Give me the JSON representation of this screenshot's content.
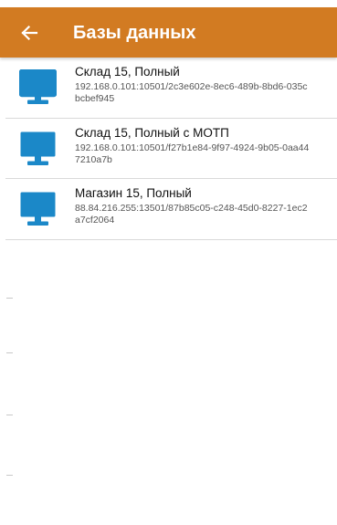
{
  "app_bar": {
    "title": "Базы данных",
    "back_icon": "arrow-left-icon",
    "color": "#d27b22"
  },
  "databases": [
    {
      "icon": "monitor-icon",
      "name": "Склад 15, Полный",
      "address": "192.168.0.101:10501/2c3e602e-8ec6-489b-8bd6-035cbcbef945"
    },
    {
      "icon": "monitor-icon",
      "name": "Склад 15, Полный с МОТП",
      "address": "192.168.0.101:10501/f27b1e84-9f97-4924-9b05-0aa447210a7b"
    },
    {
      "icon": "monitor-icon",
      "name": "Магазин 15, Полный",
      "address": "88.84.216.255:13501/87b85c05-c248-45d0-8227-1ec2a7cf2064"
    }
  ],
  "icon_color": "#1b88c8"
}
